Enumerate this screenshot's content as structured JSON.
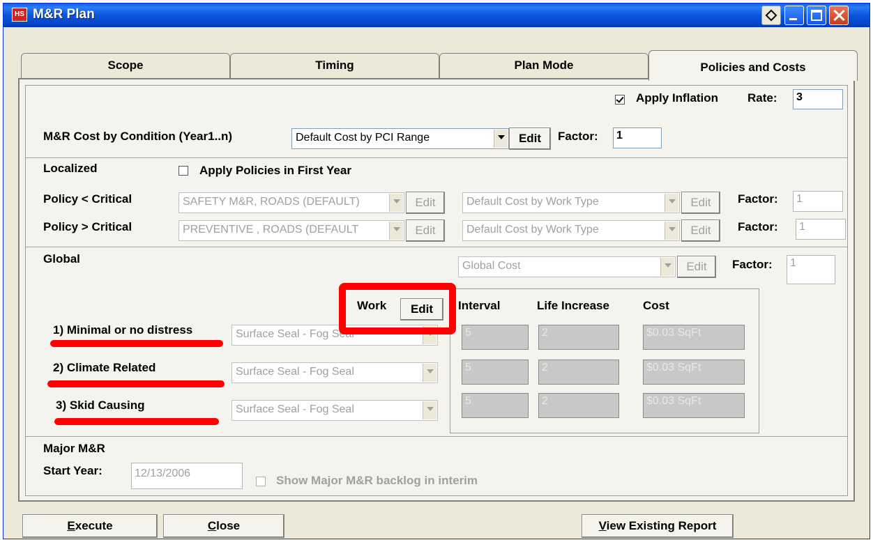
{
  "window": {
    "title": "M&R Plan",
    "app_icon_text": "HS",
    "controls": [
      "help-icon",
      "minimize-icon",
      "maximize-icon",
      "close-icon"
    ]
  },
  "tabs": [
    {
      "label": "Scope",
      "active": false
    },
    {
      "label": "Timing",
      "active": false
    },
    {
      "label": "Plan Mode",
      "active": false
    },
    {
      "label": "Policies and Costs",
      "active": true
    }
  ],
  "inflation": {
    "label": "Apply Inflation",
    "checked": true,
    "rate_label": "Rate:",
    "rate_value": "3"
  },
  "cost_by_condition": {
    "label": "M&R Cost by Condition  (Year1..n)",
    "selected": "Default Cost by PCI Range",
    "edit_label": "Edit",
    "factor_label": "Factor:",
    "factor_value": "1"
  },
  "localized": {
    "heading": "Localized",
    "apply_first_year_label": "Apply Policies in First Year",
    "rows": [
      {
        "label": "Policy < Critical",
        "policy": "SAFETY M&R, ROADS (DEFAULT)",
        "cost": "Default Cost by Work Type",
        "edit1": "Edit",
        "edit2": "Edit",
        "factor_label": "Factor:",
        "factor_value": "1"
      },
      {
        "label": "Policy > Critical",
        "policy": "PREVENTIVE , ROADS (DEFAULT",
        "cost": "Default Cost by Work Type",
        "edit1": "Edit",
        "edit2": "Edit",
        "factor_label": "Factor:",
        "factor_value": "1"
      }
    ]
  },
  "global": {
    "heading": "Global",
    "cost_selected": "Global Cost",
    "edit_label": "Edit",
    "factor_label": "Factor:",
    "factor_value": "1",
    "headers": {
      "work": "Work",
      "work_edit": "Edit",
      "interval": "Interval",
      "life_increase": "Life Increase",
      "cost": "Cost"
    },
    "rows": [
      {
        "label": "1) Minimal or no distress",
        "work": "Surface Seal - Fog Seal",
        "interval": "5",
        "life_increase": "2",
        "cost": "$0.03 SqFt"
      },
      {
        "label": "2) Climate Related",
        "work": "Surface Seal - Fog Seal",
        "interval": "5",
        "life_increase": "2",
        "cost": "$0.03 SqFt"
      },
      {
        "label": "3) Skid Causing",
        "work": "Surface Seal - Fog Seal",
        "interval": "5",
        "life_increase": "2",
        "cost": "$0.03 SqFt"
      }
    ]
  },
  "major": {
    "heading": "Major M&R",
    "start_year_label": "Start Year:",
    "start_year_value": "12/13/2006",
    "backlog_label": "Show Major M&R backlog in interim"
  },
  "footer": {
    "execute_underline": "E",
    "execute_rest": "xecute",
    "close_underline": "C",
    "close_rest": "lose",
    "report_underline": "V",
    "report_rest": "iew Existing Report"
  },
  "annotation_color": "#ff0000"
}
